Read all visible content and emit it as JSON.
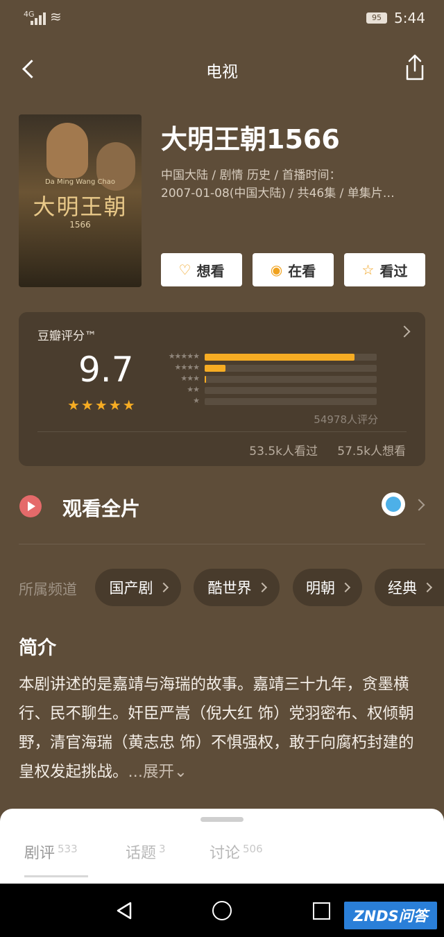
{
  "status_bar": {
    "network": "4G",
    "battery": "95",
    "time": "5:44"
  },
  "header": {
    "title": "电视"
  },
  "show": {
    "name": "大明王朝1566",
    "meta_line1": "中国大陆 / 剧情 历史 / 首播时间：",
    "meta_line2": "2007-01-08(中国大陆) / 共46集 / 单集片…",
    "poster_title": "大明王朝",
    "poster_subtitle": "1566",
    "poster_english": "Da Ming Wang Chao"
  },
  "actions": {
    "want": "想看",
    "watching": "在看",
    "watched": "看过"
  },
  "rating": {
    "label": "豆瓣评分™",
    "score": "9.7",
    "stars": "★★★★★",
    "distribution": [
      {
        "stars": "★★★★★",
        "fraction": 0.87
      },
      {
        "stars": "★★★★",
        "fraction": 0.12
      },
      {
        "stars": "★★★",
        "fraction": 0.01
      },
      {
        "stars": "★★",
        "fraction": 0.0
      },
      {
        "stars": "★",
        "fraction": 0.0
      }
    ],
    "votes": "54978人评分",
    "watched_count": "53.5k人看过",
    "wanted_count": "57.5k人想看"
  },
  "watch": {
    "label": "观看全片"
  },
  "channels": {
    "label": "所属频道",
    "items": [
      "国产剧",
      "酷世界",
      "明朝",
      "经典"
    ]
  },
  "intro": {
    "heading": "简介",
    "text": "本剧讲述的是嘉靖与海瑞的故事。嘉靖三十九年，贪墨横行、民不聊生。奸臣严嵩（倪大红 饰）党羽密布、权倾朝野，清官海瑞（黄志忠 饰）不惧强权，敢于向腐朽封建的皇权发起挑战。",
    "more": "...展开⌄"
  },
  "tabs": [
    {
      "label": "剧评",
      "count": "533"
    },
    {
      "label": "话题",
      "count": "3"
    },
    {
      "label": "讨论",
      "count": "506"
    }
  ],
  "watermark": "ZNDS问答"
}
